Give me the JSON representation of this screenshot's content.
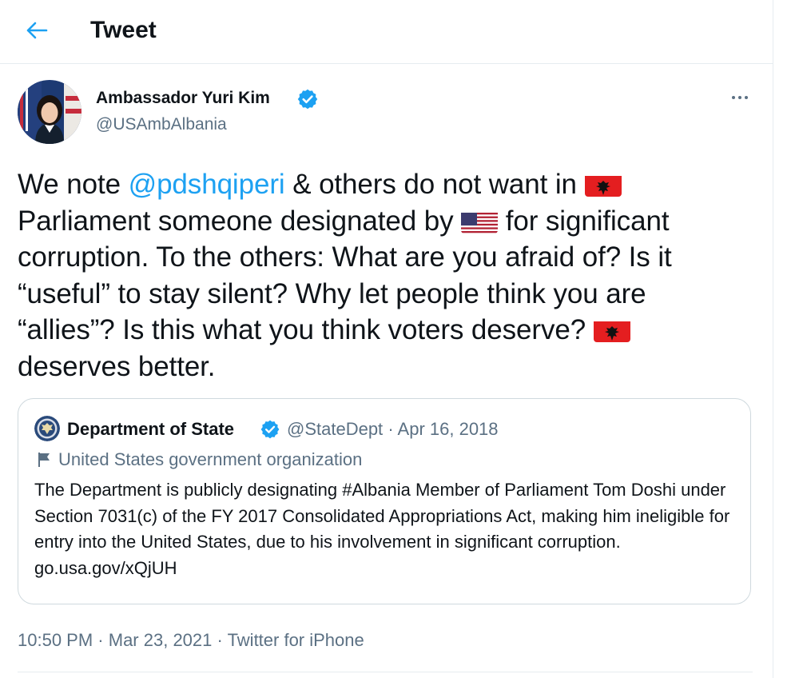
{
  "header": {
    "title": "Tweet",
    "back_icon": "arrow-left-icon"
  },
  "author": {
    "display_name": "Ambassador Yuri Kim",
    "handle": "@USAmbAlbania",
    "verified_icon": "verified-badge-icon"
  },
  "tweet": {
    "text_parts": {
      "p1": "We note ",
      "mention": "@pdshqiperi",
      "p2": " & others do not want in ",
      "p3": " Parliament someone designated by ",
      "p4": " for significant corruption. To the others: What are you afraid of? Is it “useful” to stay silent? Why let people think you are “allies”? Is this what you think voters deserve? ",
      "p5": " deserves better."
    },
    "flags": [
      "albania-flag-icon",
      "us-flag-icon",
      "albania-flag-icon"
    ]
  },
  "quote": {
    "name": "Department of State",
    "handle": "@StateDept",
    "separator": "·",
    "date": "Apr 16, 2018",
    "label": "United States government organization",
    "text": "The Department is publicly designating #Albania Member of Parliament Tom Doshi under Section 7031(c) of the FY 2017 Consolidated Appropriations Act, making him ineligible for entry into the United States, due to his involvement in significant corruption. go.usa.gov/xQjUH"
  },
  "footer": {
    "time": "10:50 PM",
    "sep1": "·",
    "date": "Mar 23, 2021",
    "sep2": "·",
    "source": "Twitter for iPhone"
  },
  "colors": {
    "accent": "#1da1f2",
    "secondary_text": "#5b7083",
    "border": "#cfd9de",
    "albania_red": "#e41e20"
  }
}
